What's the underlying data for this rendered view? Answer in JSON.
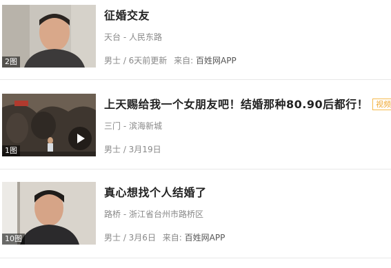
{
  "listings": [
    {
      "title": "征婚交友",
      "location": "天台 - 人民东路",
      "meta": "男士 / 6天前更新",
      "source_prefix": "来自:",
      "source": "百姓网APP",
      "photo_count": "2图"
    },
    {
      "title": "上天赐给我一个女朋友吧！结婚那种80.90后都行！",
      "badge": "视频",
      "location": "三门 - 滨海新城",
      "meta": "男士 / 3月19日",
      "photo_count": "1图"
    },
    {
      "title": "真心想找个人结婚了",
      "location": "路桥 - 浙江省台州市路桥区",
      "meta": "男士 / 3月6日",
      "source_prefix": "来自:",
      "source": "百姓网APP",
      "photo_count": "10图"
    }
  ],
  "colors": {
    "title": "#222222",
    "secondary_text": "#888888",
    "video_badge": "#f0a830",
    "divider": "#e8e8e8"
  }
}
